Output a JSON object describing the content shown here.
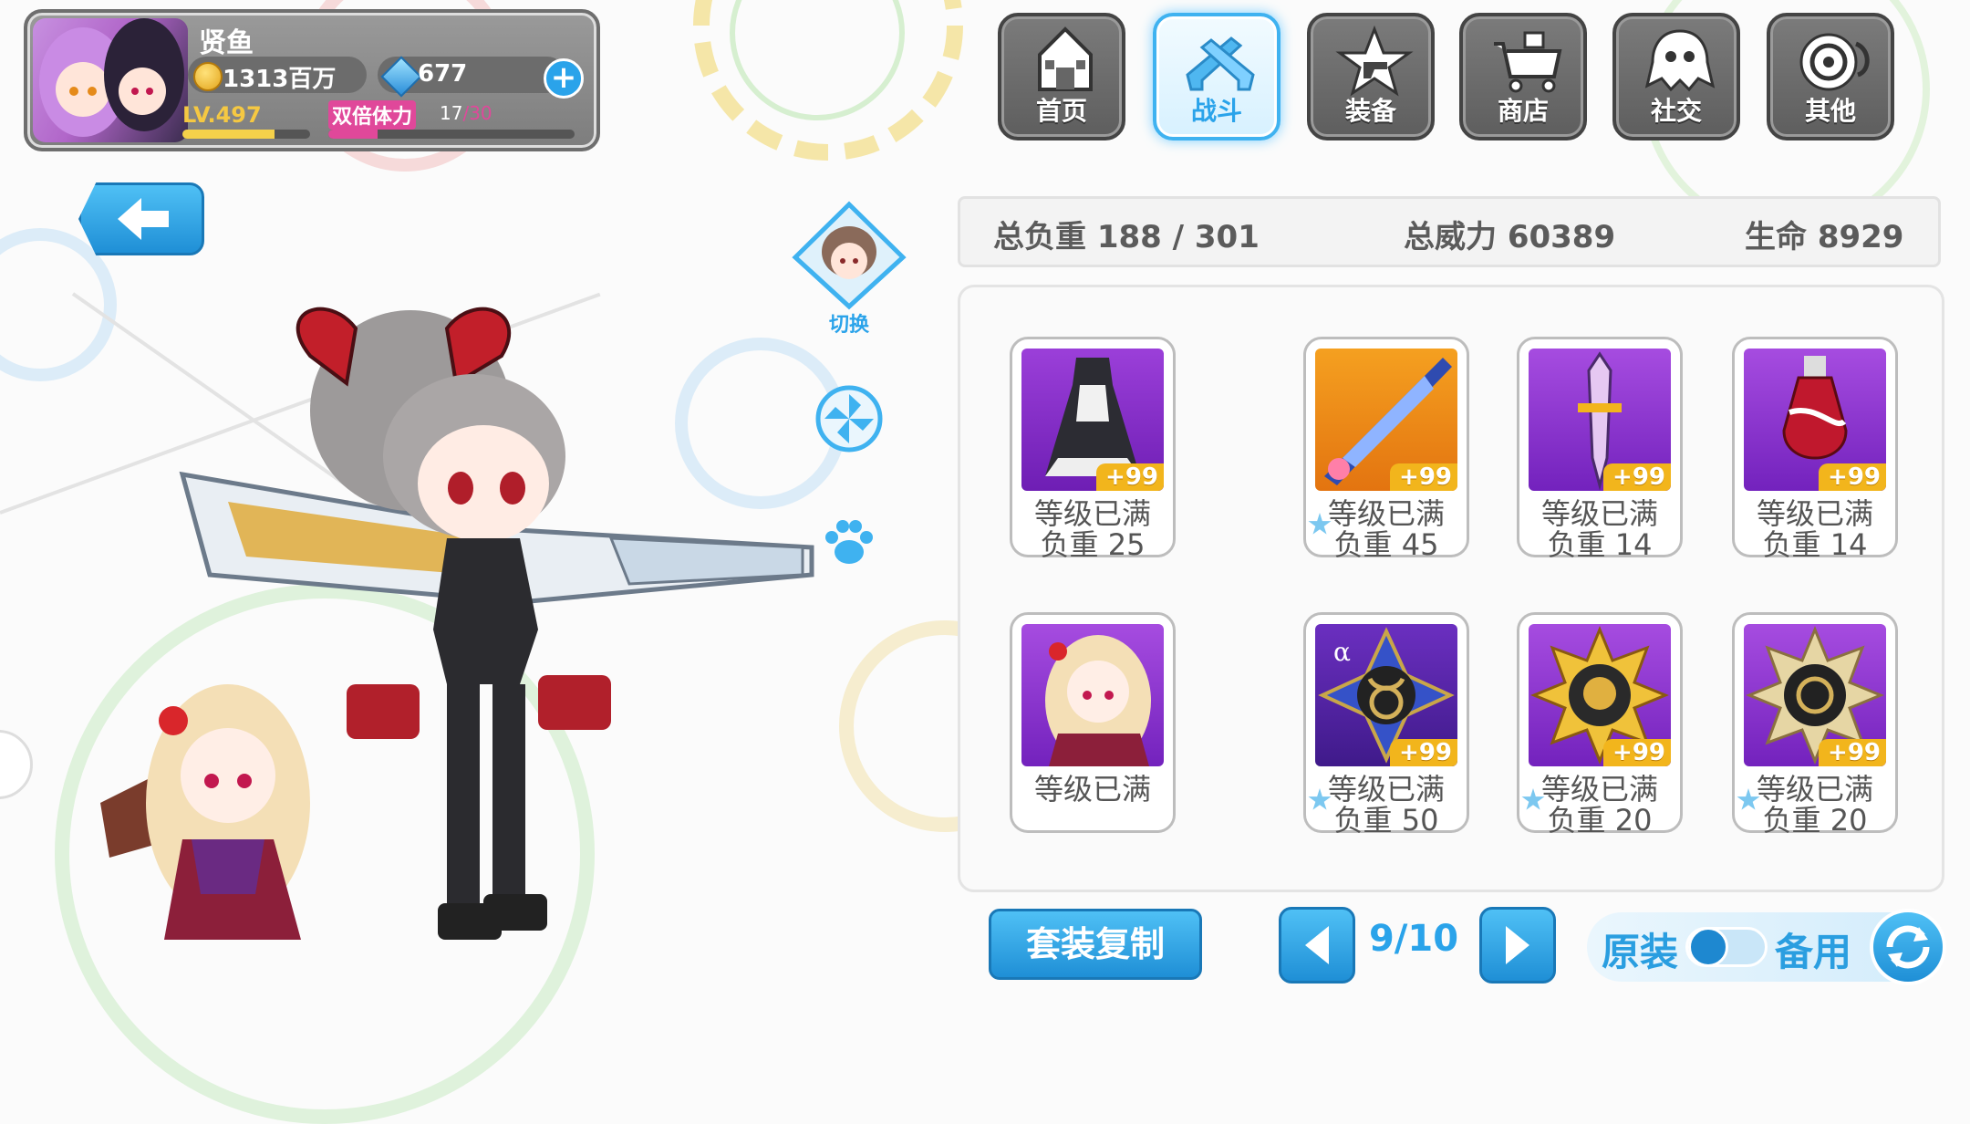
{
  "player": {
    "name": "贤鱼",
    "gold": "1313百万",
    "gems": "677",
    "level": "LV.497",
    "level_progress": 0.72,
    "stamina_label": "双倍体力",
    "stamina_current": "17",
    "stamina_max": "/30",
    "stamina_progress": 0.2
  },
  "nav": [
    {
      "label": "首页",
      "icon": "house-icon",
      "active": false
    },
    {
      "label": "战斗",
      "icon": "crossed-guns-icon",
      "active": true
    },
    {
      "label": "装备",
      "icon": "star-gun-icon",
      "active": false
    },
    {
      "label": "商店",
      "icon": "shop-cart-icon",
      "active": false
    },
    {
      "label": "社交",
      "icon": "social-ghost-icon",
      "active": false
    },
    {
      "label": "其他",
      "icon": "target-swirl-icon",
      "active": false
    }
  ],
  "switch_label": "切换",
  "stats": {
    "total_weight": "总负重 188 / 301",
    "total_power": "总威力 60389",
    "hp": "生命 8929"
  },
  "equipment": [
    {
      "status": "等级已满",
      "weight": "负重 25",
      "plus": "+99",
      "theme": "purple"
    },
    {
      "status": "等级已满",
      "weight": "负重 45",
      "plus": "+99",
      "theme": "orange"
    },
    {
      "status": "等级已满",
      "weight": "负重 14",
      "plus": "+99",
      "theme": "purple"
    },
    {
      "status": "等级已满",
      "weight": "负重 14",
      "plus": "+99",
      "theme": "purple"
    },
    {
      "status": "等级已满",
      "weight": "",
      "plus": "",
      "theme": "purple"
    },
    {
      "status": "等级已满",
      "weight": "负重 50",
      "plus": "+99",
      "theme": "purple"
    },
    {
      "status": "等级已满",
      "weight": "负重 20",
      "plus": "+99",
      "theme": "purple"
    },
    {
      "status": "等级已满",
      "weight": "负重 20",
      "plus": "+99",
      "theme": "purple"
    }
  ],
  "bottom": {
    "copy_label": "套装复制",
    "page": "9/10",
    "toggle_left": "原装",
    "toggle_right": "备用"
  },
  "colors": {
    "accent": "#2aa3ea",
    "nav_bg": "#6b6b6b",
    "purple": "#8a2fc8",
    "orange": "#f08a12",
    "gold_badge": "#f2b51c",
    "stamina": "#e0489a"
  }
}
